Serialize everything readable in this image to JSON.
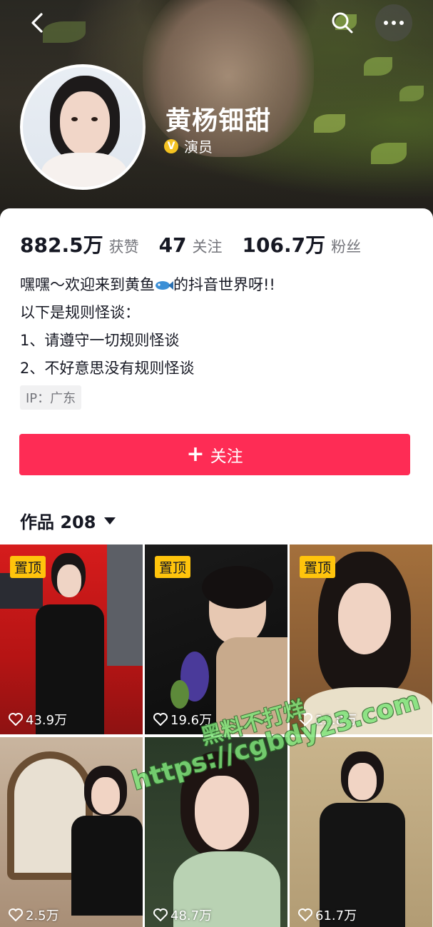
{
  "header": {
    "back_icon": "chevron-left-icon",
    "search_icon": "search-icon",
    "more_icon": "more-horizontal-icon"
  },
  "profile": {
    "name": "黄杨钿甜",
    "verify_badge": "V",
    "verify_label": "演员",
    "avatar": "avatar-photo"
  },
  "stats": [
    {
      "value": "882.5万",
      "label": "获赞"
    },
    {
      "value": "47",
      "label": "关注"
    },
    {
      "value": "106.7万",
      "label": "粉丝"
    }
  ],
  "bio": {
    "line1_before": "嘿嘿～欢迎来到黄鱼",
    "line1_icon": "fish-emoji-icon",
    "line1_after": "的抖音世界呀!!",
    "line2": "以下是规则怪谈：",
    "line3": "1、请遵守一切规则怪谈",
    "line4": "2、不好意思没有规则怪谈"
  },
  "ip_tag": "IP：广东",
  "follow_button": {
    "plus": "+",
    "label": "关注",
    "color": "#fe2c55"
  },
  "works": {
    "label": "作品 208"
  },
  "grid": [
    {
      "pinned": "置顶",
      "likes": "43.9万"
    },
    {
      "pinned": "置顶",
      "likes": "19.6万"
    },
    {
      "pinned": "置顶",
      "likes": "25.8万"
    },
    {
      "pinned": "",
      "likes": "2.5万"
    },
    {
      "pinned": "",
      "likes": "48.7万"
    },
    {
      "pinned": "",
      "likes": "61.7万"
    }
  ],
  "watermark": {
    "line1": "黑料不打烊",
    "line2": "https://cgbdy23.com"
  },
  "colors": {
    "accent": "#fe2c55",
    "pin": "#ffc40c",
    "verify": "#f5c321"
  }
}
